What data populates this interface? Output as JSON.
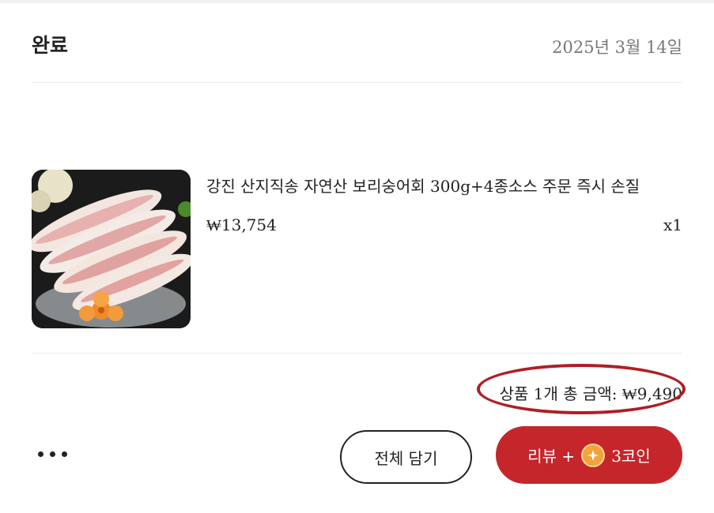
{
  "order": {
    "status": "완료",
    "date": "2025년 3월 14일"
  },
  "item": {
    "name": "강진 산지직송 자연산 보리숭어회 300g+4종소스 주문 즉시 손질",
    "price": "₩13,754",
    "quantity": "x1"
  },
  "summary": {
    "total_text": "상품 1개 총 금액: ₩9,490"
  },
  "actions": {
    "add_all_label": "전체 담기",
    "review_label_prefix": "리뷰 +",
    "review_label_suffix": "3코인"
  },
  "icons": {
    "more": "more-dots-icon",
    "coin": "coin-icon"
  },
  "colors": {
    "accent": "#c4262b",
    "highlight_oval": "#b01e24",
    "coin": "#f2a33a"
  }
}
